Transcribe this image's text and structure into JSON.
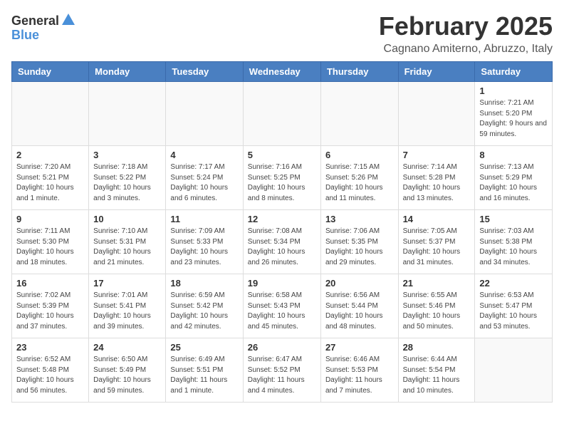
{
  "logo": {
    "general": "General",
    "blue": "Blue"
  },
  "title": "February 2025",
  "location": "Cagnano Amiterno, Abruzzo, Italy",
  "weekdays": [
    "Sunday",
    "Monday",
    "Tuesday",
    "Wednesday",
    "Thursday",
    "Friday",
    "Saturday"
  ],
  "weeks": [
    [
      {
        "day": "",
        "info": ""
      },
      {
        "day": "",
        "info": ""
      },
      {
        "day": "",
        "info": ""
      },
      {
        "day": "",
        "info": ""
      },
      {
        "day": "",
        "info": ""
      },
      {
        "day": "",
        "info": ""
      },
      {
        "day": "1",
        "info": "Sunrise: 7:21 AM\nSunset: 5:20 PM\nDaylight: 9 hours and 59 minutes."
      }
    ],
    [
      {
        "day": "2",
        "info": "Sunrise: 7:20 AM\nSunset: 5:21 PM\nDaylight: 10 hours and 1 minute."
      },
      {
        "day": "3",
        "info": "Sunrise: 7:18 AM\nSunset: 5:22 PM\nDaylight: 10 hours and 3 minutes."
      },
      {
        "day": "4",
        "info": "Sunrise: 7:17 AM\nSunset: 5:24 PM\nDaylight: 10 hours and 6 minutes."
      },
      {
        "day": "5",
        "info": "Sunrise: 7:16 AM\nSunset: 5:25 PM\nDaylight: 10 hours and 8 minutes."
      },
      {
        "day": "6",
        "info": "Sunrise: 7:15 AM\nSunset: 5:26 PM\nDaylight: 10 hours and 11 minutes."
      },
      {
        "day": "7",
        "info": "Sunrise: 7:14 AM\nSunset: 5:28 PM\nDaylight: 10 hours and 13 minutes."
      },
      {
        "day": "8",
        "info": "Sunrise: 7:13 AM\nSunset: 5:29 PM\nDaylight: 10 hours and 16 minutes."
      }
    ],
    [
      {
        "day": "9",
        "info": "Sunrise: 7:11 AM\nSunset: 5:30 PM\nDaylight: 10 hours and 18 minutes."
      },
      {
        "day": "10",
        "info": "Sunrise: 7:10 AM\nSunset: 5:31 PM\nDaylight: 10 hours and 21 minutes."
      },
      {
        "day": "11",
        "info": "Sunrise: 7:09 AM\nSunset: 5:33 PM\nDaylight: 10 hours and 23 minutes."
      },
      {
        "day": "12",
        "info": "Sunrise: 7:08 AM\nSunset: 5:34 PM\nDaylight: 10 hours and 26 minutes."
      },
      {
        "day": "13",
        "info": "Sunrise: 7:06 AM\nSunset: 5:35 PM\nDaylight: 10 hours and 29 minutes."
      },
      {
        "day": "14",
        "info": "Sunrise: 7:05 AM\nSunset: 5:37 PM\nDaylight: 10 hours and 31 minutes."
      },
      {
        "day": "15",
        "info": "Sunrise: 7:03 AM\nSunset: 5:38 PM\nDaylight: 10 hours and 34 minutes."
      }
    ],
    [
      {
        "day": "16",
        "info": "Sunrise: 7:02 AM\nSunset: 5:39 PM\nDaylight: 10 hours and 37 minutes."
      },
      {
        "day": "17",
        "info": "Sunrise: 7:01 AM\nSunset: 5:41 PM\nDaylight: 10 hours and 39 minutes."
      },
      {
        "day": "18",
        "info": "Sunrise: 6:59 AM\nSunset: 5:42 PM\nDaylight: 10 hours and 42 minutes."
      },
      {
        "day": "19",
        "info": "Sunrise: 6:58 AM\nSunset: 5:43 PM\nDaylight: 10 hours and 45 minutes."
      },
      {
        "day": "20",
        "info": "Sunrise: 6:56 AM\nSunset: 5:44 PM\nDaylight: 10 hours and 48 minutes."
      },
      {
        "day": "21",
        "info": "Sunrise: 6:55 AM\nSunset: 5:46 PM\nDaylight: 10 hours and 50 minutes."
      },
      {
        "day": "22",
        "info": "Sunrise: 6:53 AM\nSunset: 5:47 PM\nDaylight: 10 hours and 53 minutes."
      }
    ],
    [
      {
        "day": "23",
        "info": "Sunrise: 6:52 AM\nSunset: 5:48 PM\nDaylight: 10 hours and 56 minutes."
      },
      {
        "day": "24",
        "info": "Sunrise: 6:50 AM\nSunset: 5:49 PM\nDaylight: 10 hours and 59 minutes."
      },
      {
        "day": "25",
        "info": "Sunrise: 6:49 AM\nSunset: 5:51 PM\nDaylight: 11 hours and 1 minute."
      },
      {
        "day": "26",
        "info": "Sunrise: 6:47 AM\nSunset: 5:52 PM\nDaylight: 11 hours and 4 minutes."
      },
      {
        "day": "27",
        "info": "Sunrise: 6:46 AM\nSunset: 5:53 PM\nDaylight: 11 hours and 7 minutes."
      },
      {
        "day": "28",
        "info": "Sunrise: 6:44 AM\nSunset: 5:54 PM\nDaylight: 11 hours and 10 minutes."
      },
      {
        "day": "",
        "info": ""
      }
    ]
  ]
}
